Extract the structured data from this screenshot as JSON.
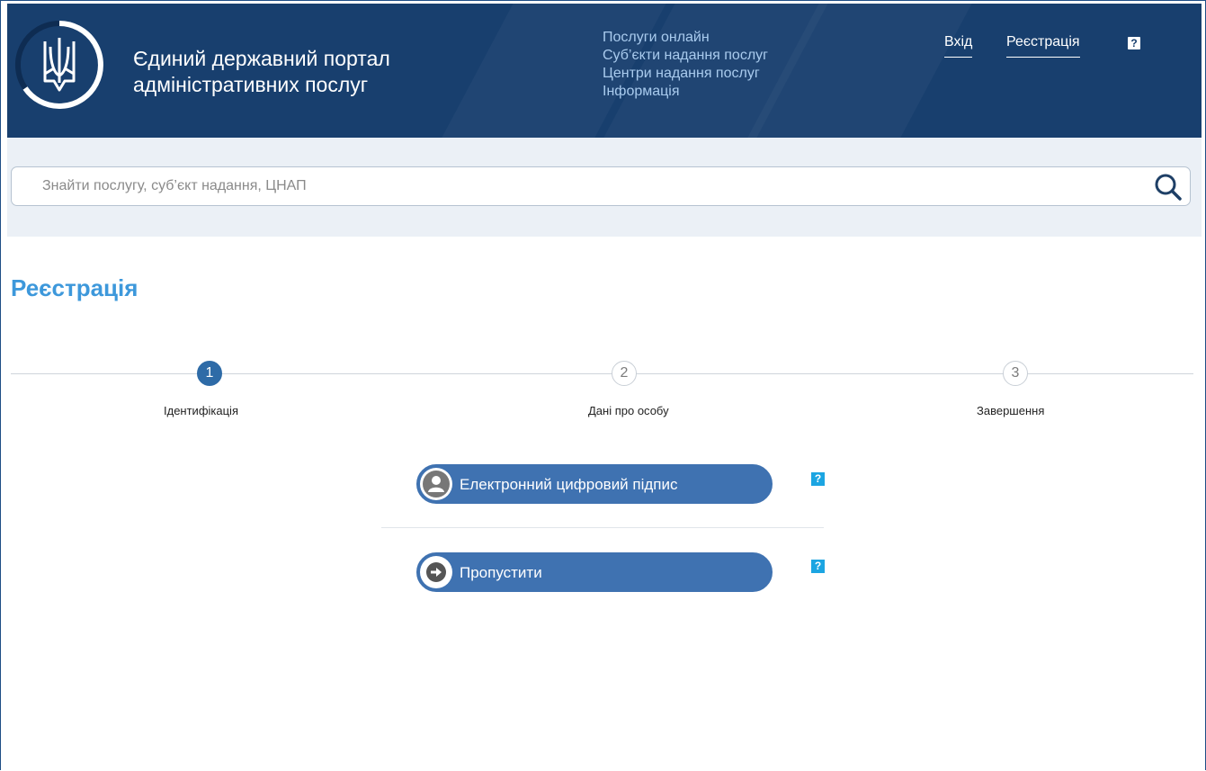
{
  "header": {
    "title_line1": "Єдиний державний портал",
    "title_line2": "адміністративних послуг",
    "nav": [
      "Послуги онлайн",
      "Суб’єкти надання послуг",
      "Центри надання послуг",
      "Інформація"
    ],
    "login": "Вхід",
    "register": "Реєстрація",
    "help": "?"
  },
  "search": {
    "placeholder": "Знайти послугу, суб’єкт надання, ЦНАП",
    "icon": "search-icon"
  },
  "page": {
    "title": "Реєстрація"
  },
  "steps": [
    {
      "number": "1",
      "label": "Ідентифікація",
      "active": true
    },
    {
      "number": "2",
      "label": "Дані про особу",
      "active": false
    },
    {
      "number": "3",
      "label": "Завершення",
      "active": false
    }
  ],
  "options": [
    {
      "label": "Електронний цифровий підпис",
      "icon": "user-icon",
      "help": "?"
    },
    {
      "label": "Пропустити",
      "icon": "arrow-right-icon",
      "help": "?"
    }
  ],
  "colors": {
    "header_bg": "#183f6e",
    "nav_link": "#a9cbee",
    "accent": "#3d98db",
    "button": "#3f72b1",
    "help_badge": "#1ca5e2",
    "search_band": "#ebf0f6"
  }
}
